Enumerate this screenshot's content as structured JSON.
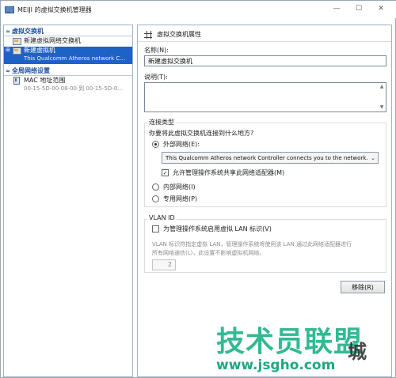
{
  "window": {
    "title": "MEIJI 的虚拟交换机管理器",
    "min": "—",
    "max": "☐",
    "close": "✕"
  },
  "tree": {
    "section1": "虚拟交换机",
    "new_switch": "新建虚拟网络交换机",
    "selected_switch": "新建虚拟机",
    "selected_switch_sub": "This Qualcomm Atheros network C...",
    "section2": "全局网络设置",
    "mac_label": "MAC 地址范围",
    "mac_sub": "00-15-5D-00-08-00 到 00-15-5D-0..."
  },
  "props": {
    "header": "虚拟交换机属性",
    "name_label": "名称(N):",
    "name_value": "新建虚拟交换机",
    "notes_label": "说明(T):",
    "conn_group": "连接类型",
    "conn_question": "你要将此虚拟交换机连接到什么地方?",
    "external": "外部网络(E):",
    "adapter": "This Qualcomm Atheros network Controller connects you to the network.",
    "allow_mgmt": "允许管理操作系统共享此网络适配器(M)",
    "internal": "内部网络(I)",
    "private": "专用网络(P)",
    "vlan_group": "VLAN ID",
    "vlan_check": "为管理操作系统启用虚拟 LAN 标识(V)",
    "vlan_desc1": "VLAN 标识符指定虚拟 LAN，管理操作系统将使用该 LAN 通过此网络适配器进行",
    "vlan_desc2": "所有网络通信(L)，此设置不影响虚拟机网络。",
    "vlan_value": "2",
    "remove_btn": "移除(R)"
  },
  "watermark": {
    "main": "技术员联盟",
    "side": "城",
    "url": "www.jsgho.com"
  }
}
